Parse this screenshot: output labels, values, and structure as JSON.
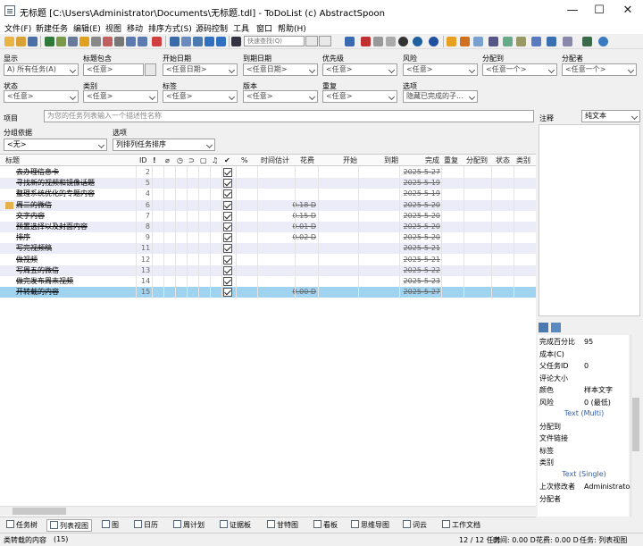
{
  "window": {
    "title": "无标题 [C:\\Users\\Administrator\\Documents\\无标题.tdl] - ToDoList (c) AbstractSpoon",
    "minimize": "—",
    "maximize": "☐",
    "close": "✕"
  },
  "menu": [
    "文件(F)",
    "新建任务",
    "编辑(E)",
    "视图",
    "移动",
    "排序方式(S)",
    "源码控制",
    "工具",
    "窗口",
    "帮助(H)"
  ],
  "toolbar": {
    "quickfind_placeholder": "快速查找(Q)"
  },
  "filters": {
    "row1": [
      {
        "label": "显示",
        "value": "A) 所有任务(A)"
      },
      {
        "label": "标题包含",
        "value": "<任意>"
      },
      {
        "label": "开始日期",
        "value": "<任意日期>"
      },
      {
        "label": "到期日期",
        "value": "<任意日期>"
      },
      {
        "label": "优先级",
        "value": "<任意>"
      },
      {
        "label": "风险",
        "value": "<任意>"
      },
      {
        "label": "分配到",
        "value": "<任意一个>"
      },
      {
        "label": "分配者",
        "value": "<任意一个>"
      }
    ],
    "row2": [
      {
        "label": "状态",
        "value": "<任意>"
      },
      {
        "label": "类别",
        "value": "<任意>"
      },
      {
        "label": "标签",
        "value": "<任意>"
      },
      {
        "label": "版本",
        "value": "<任意>"
      },
      {
        "label": "重复",
        "value": "<任意>"
      },
      {
        "label": "选项",
        "value": "隐藏已完成的子..."
      }
    ]
  },
  "project": {
    "label": "项目",
    "placeholder": "为您的任务列表输入一个描述性名称"
  },
  "grouping": {
    "group_label": "分组依据",
    "group_value": "<无>",
    "options_label": "选项",
    "options_value": "列排列任务排序"
  },
  "columns": [
    "标题",
    "ID",
    "%",
    "时间估计",
    "花费",
    "开始",
    "到期",
    "完成",
    "重复",
    "分配到",
    "状态",
    "类别"
  ],
  "tasks": [
    {
      "title": "去办理信息卡",
      "id": "2",
      "effort": "",
      "done": "2025-5-27",
      "sel": false
    },
    {
      "title": "寻找新的视频和镜像话题",
      "id": "5",
      "effort": "",
      "done": "2025-5-19",
      "sel": false
    },
    {
      "title": "整理系统优化的专题内容",
      "id": "4",
      "effort": "",
      "done": "2025-5-19",
      "sel": false
    },
    {
      "title": "周三的微信",
      "id": "6",
      "effort": "0.18 D",
      "done": "2025-5-20",
      "sel": false
    },
    {
      "title": "文字内容",
      "id": "7",
      "effort": "0.15 D",
      "done": "2025-5-20",
      "sel": false
    },
    {
      "title": "预置选择以及封面内容",
      "id": "8",
      "effort": "0.01 D",
      "done": "2025-5-20",
      "sel": false
    },
    {
      "title": "排序",
      "id": "9",
      "effort": "0.02 D",
      "done": "2025-5-20",
      "sel": false
    },
    {
      "title": "写完视频稿",
      "id": "11",
      "effort": "",
      "done": "2025-5-21",
      "sel": false
    },
    {
      "title": "做视频",
      "id": "12",
      "effort": "",
      "done": "2025-5-21",
      "sel": false
    },
    {
      "title": "写周五的微信",
      "id": "13",
      "effort": "",
      "done": "2025-5-22",
      "sel": false
    },
    {
      "title": "做完发布周末视频",
      "id": "14",
      "effort": "",
      "done": "2025-5-23",
      "sel": false
    },
    {
      "title": "开转载的内容",
      "id": "15",
      "effort": "0.00 D",
      "done": "2025-5-27",
      "sel": true
    }
  ],
  "right_panel": {
    "comments_label": "注释",
    "comments_type": "纯文本",
    "props": [
      {
        "label": "完成百分比",
        "value": "95"
      },
      {
        "label": "成本(C)",
        "value": ""
      },
      {
        "label": "父任务ID",
        "value": "0"
      },
      {
        "label": "评论大小",
        "value": ""
      },
      {
        "label": "颜色",
        "value": "样本文字"
      },
      {
        "label": "风险",
        "value": "0 (最低)"
      }
    ],
    "group1": "Text (Multi)",
    "props2": [
      {
        "label": "分配到",
        "value": ""
      },
      {
        "label": "文件链接",
        "value": ""
      },
      {
        "label": "标签",
        "value": ""
      },
      {
        "label": "类别",
        "value": ""
      }
    ],
    "group2": "Text (Single)",
    "props3": [
      {
        "label": "上次修改者",
        "value": "Administrator"
      },
      {
        "label": "分配者",
        "value": ""
      }
    ]
  },
  "tabs": [
    "任务树",
    "列表视图",
    "图",
    "日历",
    "周计划",
    "证据板",
    "甘特图",
    "看板",
    "思维导图",
    "词云",
    "工作文档"
  ],
  "status": {
    "left": "类转载的内容",
    "count": "(15)",
    "tasks": "12 / 12 任务",
    "spent": "时间: 0.00 D",
    "estimated": "花费: 0.00 D",
    "view": "任务: 列表视图"
  }
}
